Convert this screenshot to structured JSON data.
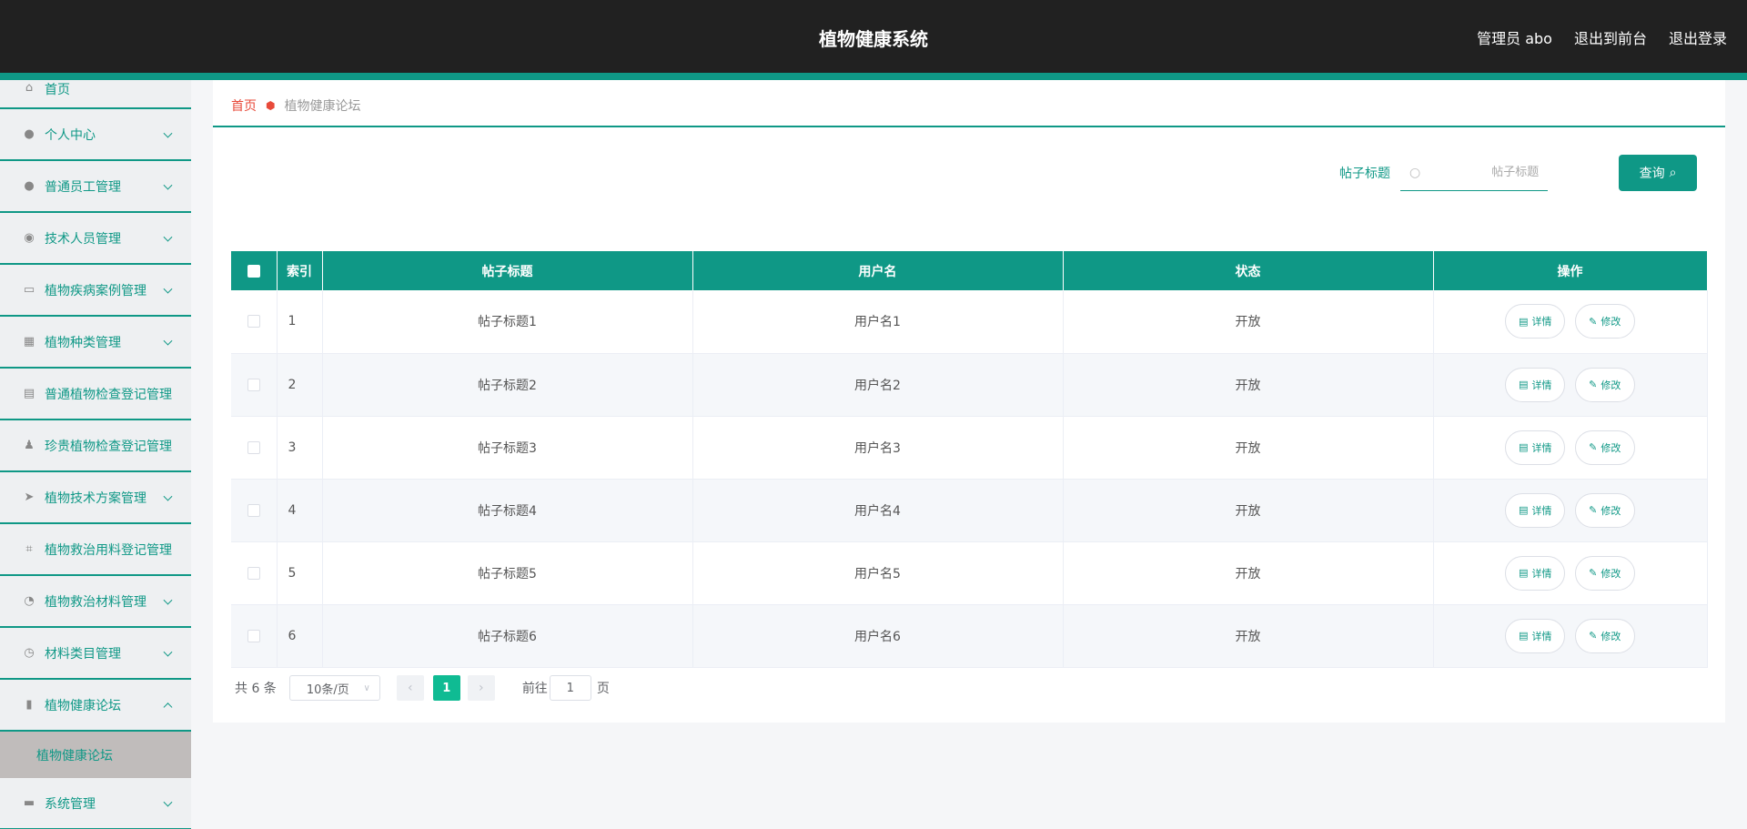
{
  "header": {
    "title": "植物健康系统",
    "user_label": "管理员 abo",
    "to_front_label": "退出到前台",
    "logout_label": "退出登录"
  },
  "sidebar": {
    "items": [
      {
        "label": "首页",
        "icon": "home-icon"
      },
      {
        "label": "个人中心",
        "icon": "user-icon"
      },
      {
        "label": "普通员工管理",
        "icon": "user-icon"
      },
      {
        "label": "技术人员管理",
        "icon": "pin-icon"
      },
      {
        "label": "植物疾病案例管理",
        "icon": "chat-icon"
      },
      {
        "label": "植物种类管理",
        "icon": "grid-icon"
      },
      {
        "label": "普通植物检查登记管理",
        "icon": "card-icon"
      },
      {
        "label": "珍贵植物检查登记管理",
        "icon": "stamp-icon"
      },
      {
        "label": "植物技术方案管理",
        "icon": "send-icon"
      },
      {
        "label": "植物救治用料登记管理",
        "icon": "crop-icon"
      },
      {
        "label": "植物救治材料管理",
        "icon": "gauge-icon"
      },
      {
        "label": "材料类目管理",
        "icon": "clock-icon"
      },
      {
        "label": "植物健康论坛",
        "icon": "clipboard-icon"
      },
      {
        "label": "系统管理",
        "icon": "briefcase-icon"
      }
    ],
    "sub_item": "植物健康论坛"
  },
  "breadcrumb": {
    "home": "首页",
    "current": "植物健康论坛"
  },
  "search": {
    "label": "帖子标题",
    "placeholder": "帖子标题",
    "button": "查询"
  },
  "table": {
    "headers": [
      "索引",
      "帖子标题",
      "用户名",
      "状态",
      "操作"
    ],
    "rows": [
      {
        "index": "1",
        "title": "帖子标题1",
        "user": "用户名1",
        "status": "开放"
      },
      {
        "index": "2",
        "title": "帖子标题2",
        "user": "用户名2",
        "status": "开放"
      },
      {
        "index": "3",
        "title": "帖子标题3",
        "user": "用户名3",
        "status": "开放"
      },
      {
        "index": "4",
        "title": "帖子标题4",
        "user": "用户名4",
        "status": "开放"
      },
      {
        "index": "5",
        "title": "帖子标题5",
        "user": "用户名5",
        "status": "开放"
      },
      {
        "index": "6",
        "title": "帖子标题6",
        "user": "用户名6",
        "status": "开放"
      }
    ],
    "detail_label": "详情",
    "edit_label": "修改"
  },
  "pagination": {
    "total": "共 6 条",
    "page_size": "10条/页",
    "current_page": "1",
    "goto_label": "前往",
    "goto_value": "1",
    "page_unit": "页"
  },
  "colors": {
    "accent": "#0f9886",
    "header_bg": "#212121",
    "breadcrumb_home": "#e84a3a",
    "active_page": "#0fbb93"
  }
}
